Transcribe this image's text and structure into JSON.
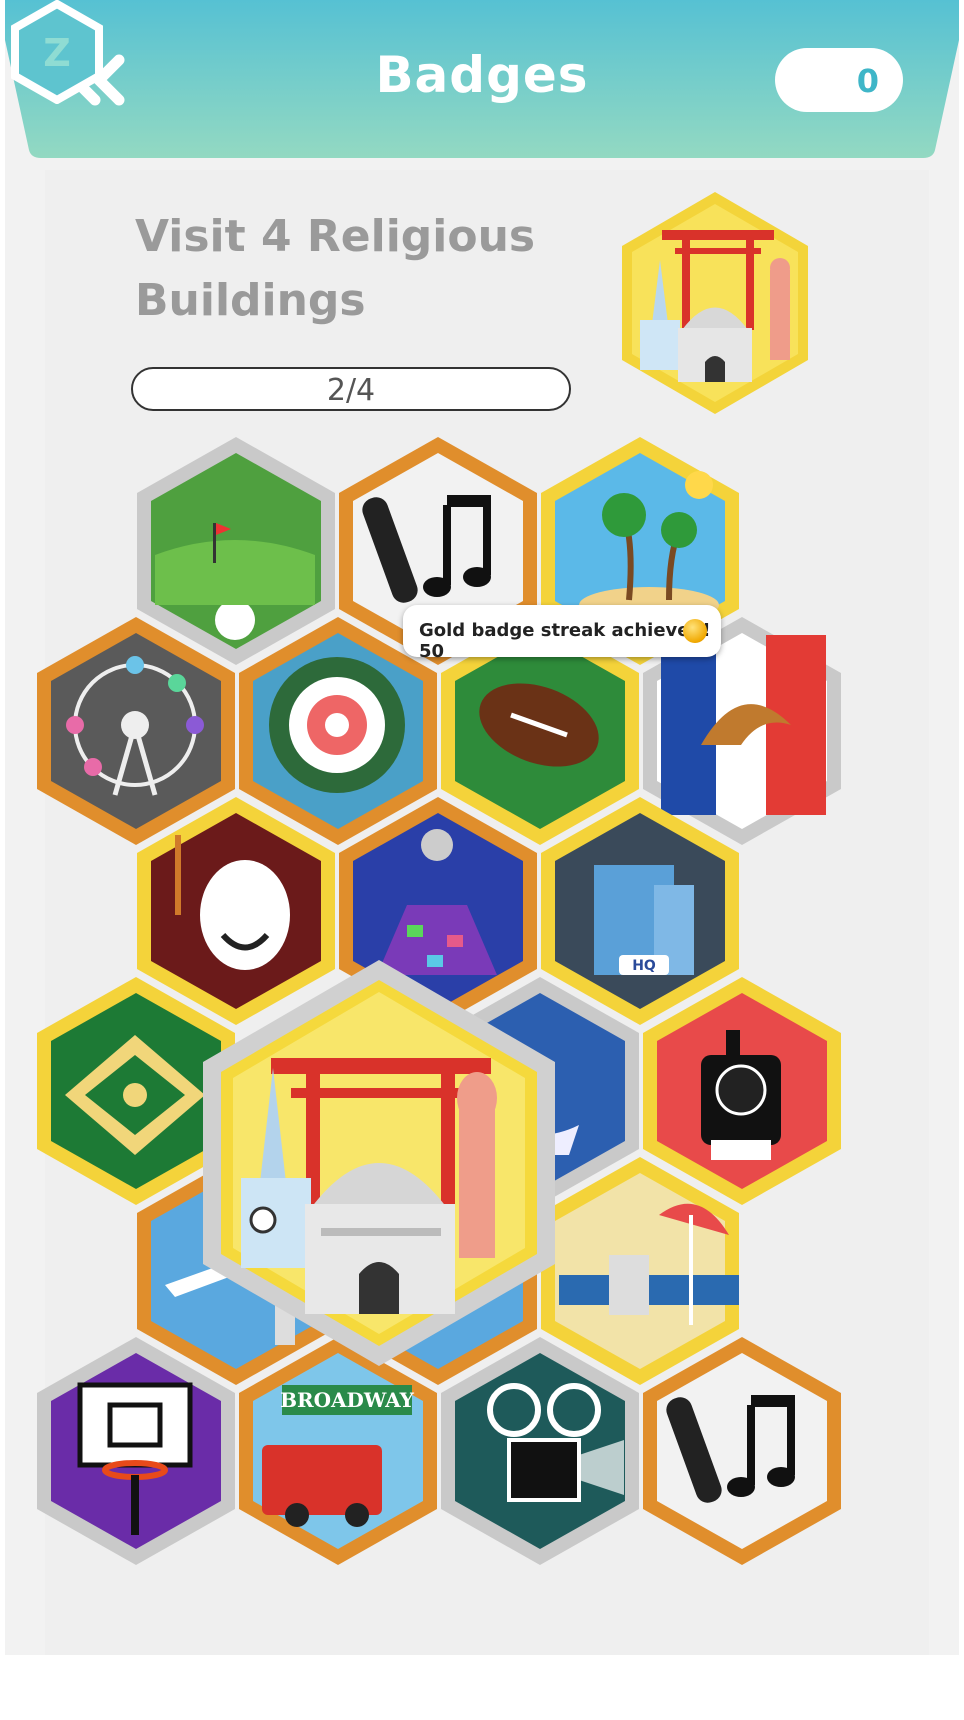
{
  "header": {
    "title": "Badges",
    "coins": "0",
    "coin_logo": "Z",
    "colors": {
      "top": "#5cc3d1",
      "bottom": "#8fd7c0",
      "text": "#ffffff"
    }
  },
  "goal": {
    "title": "Visit 4 Religious Buildings",
    "progress_text": "2/4",
    "progress_fraction": 0.5,
    "badge": "religious-buildings"
  },
  "toast": {
    "text": "Gold badge streak achieved! 50",
    "icon": "gold-coin-icon"
  },
  "badges": [
    {
      "name": "golf",
      "rim": "silver"
    },
    {
      "name": "music",
      "rim": "bronze"
    },
    {
      "name": "beach-island",
      "rim": "gold"
    },
    {
      "name": "ferris-wheel",
      "rim": "bronze"
    },
    {
      "name": "flower",
      "rim": "bronze"
    },
    {
      "name": "football",
      "rim": "gold"
    },
    {
      "name": "france-croissant",
      "rim": "silver"
    },
    {
      "name": "theatre",
      "rim": "gold"
    },
    {
      "name": "dance-club",
      "rim": "bronze"
    },
    {
      "name": "headquarters",
      "rim": "gold"
    },
    {
      "name": "baseball",
      "rim": "gold"
    },
    {
      "name": "fountain",
      "rim": "silver"
    },
    {
      "name": "train",
      "rim": "gold"
    },
    {
      "name": "airport",
      "rim": "bronze"
    },
    {
      "name": "vineyard",
      "rim": "bronze"
    },
    {
      "name": "beach-chair",
      "rim": "gold"
    },
    {
      "name": "basketball",
      "rim": "silver"
    },
    {
      "name": "broadway",
      "rim": "bronze"
    },
    {
      "name": "cinema",
      "rim": "silver"
    },
    {
      "name": "music-2",
      "rim": "bronze"
    }
  ],
  "hq_label": "HQ",
  "broadway_label": "BROADWAY",
  "rim_colors": {
    "gold": "#f4d33a",
    "silver": "#c9c9c9",
    "bronze": "#e08e2c"
  }
}
